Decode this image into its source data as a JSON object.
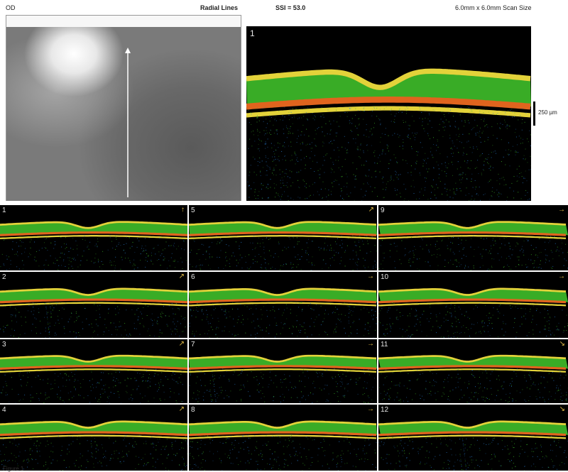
{
  "header": {
    "eye": "OD",
    "scan_type": "Radial Lines",
    "ssi": "SSI = 53.0",
    "scan_size": "6.0mm x 6.0mm Scan Size"
  },
  "main_scan": {
    "number": "1"
  },
  "scale": {
    "label": "250 µm"
  },
  "thumbnails": [
    {
      "number": "1",
      "direction_icon": "arrow-up-icon"
    },
    {
      "number": "5",
      "direction_icon": "arrow-up-right-icon"
    },
    {
      "number": "9",
      "direction_icon": "arrow-right-icon"
    },
    {
      "number": "2",
      "direction_icon": "arrow-up-right-icon"
    },
    {
      "number": "6",
      "direction_icon": "arrow-right-icon"
    },
    {
      "number": "10",
      "direction_icon": "arrow-right-icon"
    },
    {
      "number": "3",
      "direction_icon": "arrow-up-right-icon"
    },
    {
      "number": "7",
      "direction_icon": "arrow-right-icon"
    },
    {
      "number": "11",
      "direction_icon": "arrow-down-right-icon"
    },
    {
      "number": "4",
      "direction_icon": "arrow-up-right-icon"
    },
    {
      "number": "8",
      "direction_icon": "arrow-right-icon"
    },
    {
      "number": "12",
      "direction_icon": "arrow-down-right-icon"
    }
  ],
  "colors": {
    "scan_background": "#000000",
    "retina_green": "#3fbf2a",
    "retina_yellow": "#e3d23a",
    "rpe_orange": "#e0641e",
    "noise_blue": "#2a7fd4"
  },
  "footer": {
    "label": "Figure 1"
  }
}
